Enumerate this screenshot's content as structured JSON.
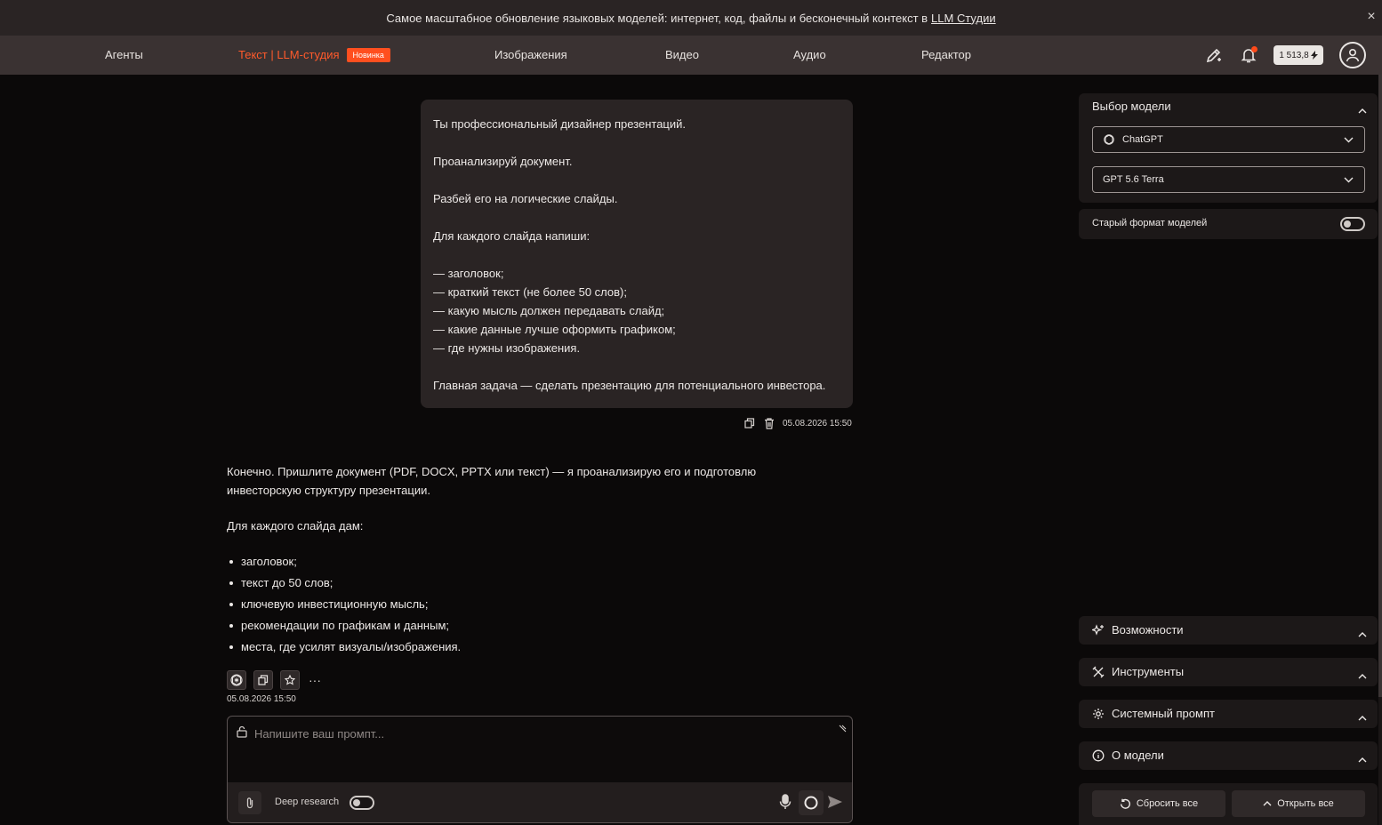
{
  "banner": {
    "text": "Самое масштабное обновление языковых моделей: интернет, код, файлы и бесконечный контекст в",
    "link": "LLM Студии",
    "close": "×"
  },
  "nav": {
    "items": [
      {
        "label": "Агенты"
      },
      {
        "label": "Текст | LLM-студия",
        "badge": "Новинка",
        "active": true
      },
      {
        "label": "Изображения"
      },
      {
        "label": "Видео"
      },
      {
        "label": "Аудио"
      },
      {
        "label": "Редактор"
      }
    ],
    "balance": "1 513,8"
  },
  "user_message": {
    "lines": [
      "Ты профессиональный дизайнер презентаций.",
      "",
      "Проанализируй документ.",
      "",
      "Разбей его на логические слайды.",
      "",
      "Для каждого слайда напиши:",
      "",
      "— заголовок;",
      "— краткий текст (не более 50 слов);",
      "— какую мысль должен передавать слайд;",
      "— какие данные лучше оформить графиком;",
      "— где нужны изображения.",
      "",
      "Главная задача — сделать презентацию для потенциального инвестора."
    ],
    "timestamp": "05.08.2026 15:50"
  },
  "assistant_message": {
    "intro_line1": "Конечно. Пришлите документ (PDF, DOCX, PPTX или текст) — я проанализирую его и подготовлю",
    "intro_line2": "инвесторскую структуру презентации.",
    "subhead": "Для каждого слайда дам:",
    "bullets": [
      "заголовок;",
      "текст до 50 слов;",
      "ключевую инвестиционную мысль;",
      "рекомендации по графикам и данным;",
      "места, где усилят визуалы/изображения."
    ],
    "more": "···",
    "timestamp": "05.08.2026 15:50"
  },
  "composer": {
    "placeholder": "Напишите ваш промпт...",
    "deep_research_label": "Deep research"
  },
  "sidebar": {
    "model_title": "Выбор модели",
    "provider": "ChatGPT",
    "model": "GPT 5.6 Terra",
    "old_format_label": "Старый формат моделей",
    "sections": [
      {
        "label": "Возможности",
        "icon": "sparkle-icon"
      },
      {
        "label": "Инструменты",
        "icon": "tools-icon"
      },
      {
        "label": "Системный промпт",
        "icon": "gear-icon"
      },
      {
        "label": "О модели",
        "icon": "info-icon"
      }
    ],
    "reset_label": "Сбросить все",
    "open_label": "Открыть все"
  },
  "colors": {
    "accent": "#ff5a2b",
    "background": "#0b0909",
    "panel": "#1c1818",
    "nav": "#3a3232"
  }
}
